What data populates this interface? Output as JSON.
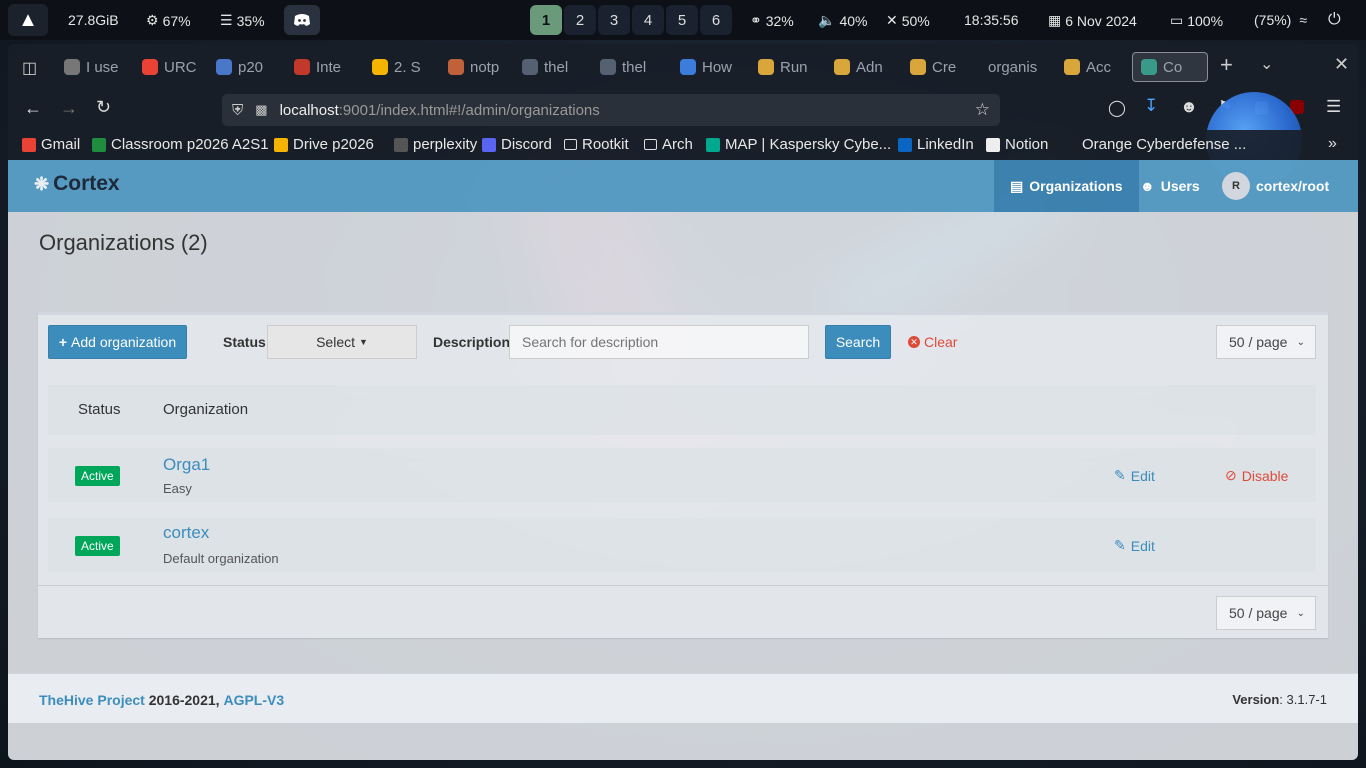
{
  "system_bar": {
    "memory": "27.8GiB",
    "cpu": "67%",
    "mem_percent": "35%",
    "workspaces": [
      "1",
      "2",
      "3",
      "4",
      "5",
      "6"
    ],
    "active_workspace": "1",
    "brightness": "32%",
    "volume": "40%",
    "mic": "50%",
    "time": "18:35:56",
    "date": "6 Nov 2024",
    "battery": "100%",
    "battery_secondary": "(75%)"
  },
  "browser": {
    "tabs": [
      {
        "label": "I use",
        "color": "#777"
      },
      {
        "label": "URC",
        "color": "#ea4335"
      },
      {
        "label": "p20",
        "color": "#4a78c9"
      },
      {
        "label": "Inte",
        "color": "#c0392b"
      },
      {
        "label": "2. S",
        "color": "#f4b400"
      },
      {
        "label": "notp",
        "color": "#c0613a"
      },
      {
        "label": "thel",
        "color": "#556070"
      },
      {
        "label": "thel",
        "color": "#556070"
      },
      {
        "label": "How",
        "color": "#3c7ddb"
      },
      {
        "label": "Run",
        "color": "#d8a63a"
      },
      {
        "label": "Adn",
        "color": "#d8a63a"
      },
      {
        "label": "Cre",
        "color": "#d8a63a"
      },
      {
        "label": "organis",
        "color": ""
      },
      {
        "label": "Acc",
        "color": "#d8a63a"
      },
      {
        "label": "Co",
        "color": "#3a9a8a"
      }
    ],
    "url_host": "localhost",
    "url_path": ":9001/index.html#!/admin/organizations",
    "bookmarks": [
      {
        "label": "Gmail",
        "color": "#ea4335"
      },
      {
        "label": "Classroom p2026 A2S1",
        "color": "#1e8e3e"
      },
      {
        "label": "Drive p2026",
        "color": "#f4b400"
      },
      {
        "label": "perplexity",
        "color": "#555"
      },
      {
        "label": "Discord",
        "color": "#5865f2"
      },
      {
        "label": "Rootkit",
        "color": ""
      },
      {
        "label": "Arch",
        "color": ""
      },
      {
        "label": "MAP | Kaspersky Cybe...",
        "color": "#00a88e"
      },
      {
        "label": "LinkedIn",
        "color": "#0a66c2"
      },
      {
        "label": "Notion",
        "color": "#eee"
      },
      {
        "label": "Orange Cyberdefense ...",
        "color": ""
      }
    ]
  },
  "app": {
    "brand": "Cortex",
    "nav": {
      "organizations": "Organizations",
      "users": "Users",
      "user_initial": "R",
      "user": "cortex/root"
    },
    "page_title": "Organizations (2)",
    "toolbar": {
      "add_label": "Add organization",
      "status_label": "Status",
      "status_select": "Select",
      "description_label": "Description",
      "description_placeholder": "Search for description",
      "search_label": "Search",
      "clear_label": "Clear",
      "page_size": "50 / page"
    },
    "table": {
      "headers": {
        "status": "Status",
        "organization": "Organization"
      },
      "rows": [
        {
          "status": "Active",
          "name": "Orga1",
          "description": "Easy",
          "edit": "Edit",
          "disable": "Disable"
        },
        {
          "status": "Active",
          "name": "cortex",
          "description": "Default organization",
          "edit": "Edit"
        }
      ]
    },
    "footer": {
      "project": "TheHive Project",
      "years": "2016-2021,",
      "license": "AGPL-V3",
      "version_label": "Version",
      "version": ": 3.1.7-1"
    }
  }
}
